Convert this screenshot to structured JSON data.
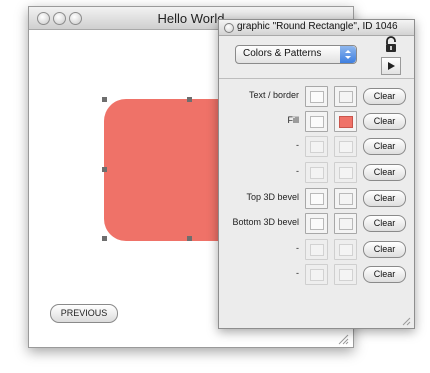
{
  "main_window": {
    "title": "Hello World",
    "previous_label": "PREVIOUS"
  },
  "shape": {
    "name": "Round Rectangle",
    "fill_color": "#ef7268"
  },
  "palette": {
    "title": "graphic \"Round Rectangle\", ID 1046",
    "category_select": "Colors & Patterns",
    "lock_icon": "lock-icon",
    "play_icon": "play-icon",
    "rows": [
      {
        "label": "Text / border",
        "clear": "Clear",
        "swatch2_color": "#f4f4f4"
      },
      {
        "label": "Fill",
        "clear": "Clear",
        "swatch2_color": "#ef7268"
      },
      {
        "label": "-",
        "clear": "Clear",
        "swatch2_color": "#f4f4f4"
      },
      {
        "label": "-",
        "clear": "Clear",
        "swatch2_color": "#f4f4f4"
      },
      {
        "label": "Top 3D bevel",
        "clear": "Clear",
        "swatch2_color": "#f4f4f4"
      },
      {
        "label": "Bottom 3D bevel",
        "clear": "Clear",
        "swatch2_color": "#f4f4f4"
      },
      {
        "label": "-",
        "clear": "Clear",
        "swatch2_color": "#f4f4f4"
      },
      {
        "label": "-",
        "clear": "Clear",
        "swatch2_color": "#f4f4f4"
      }
    ]
  }
}
